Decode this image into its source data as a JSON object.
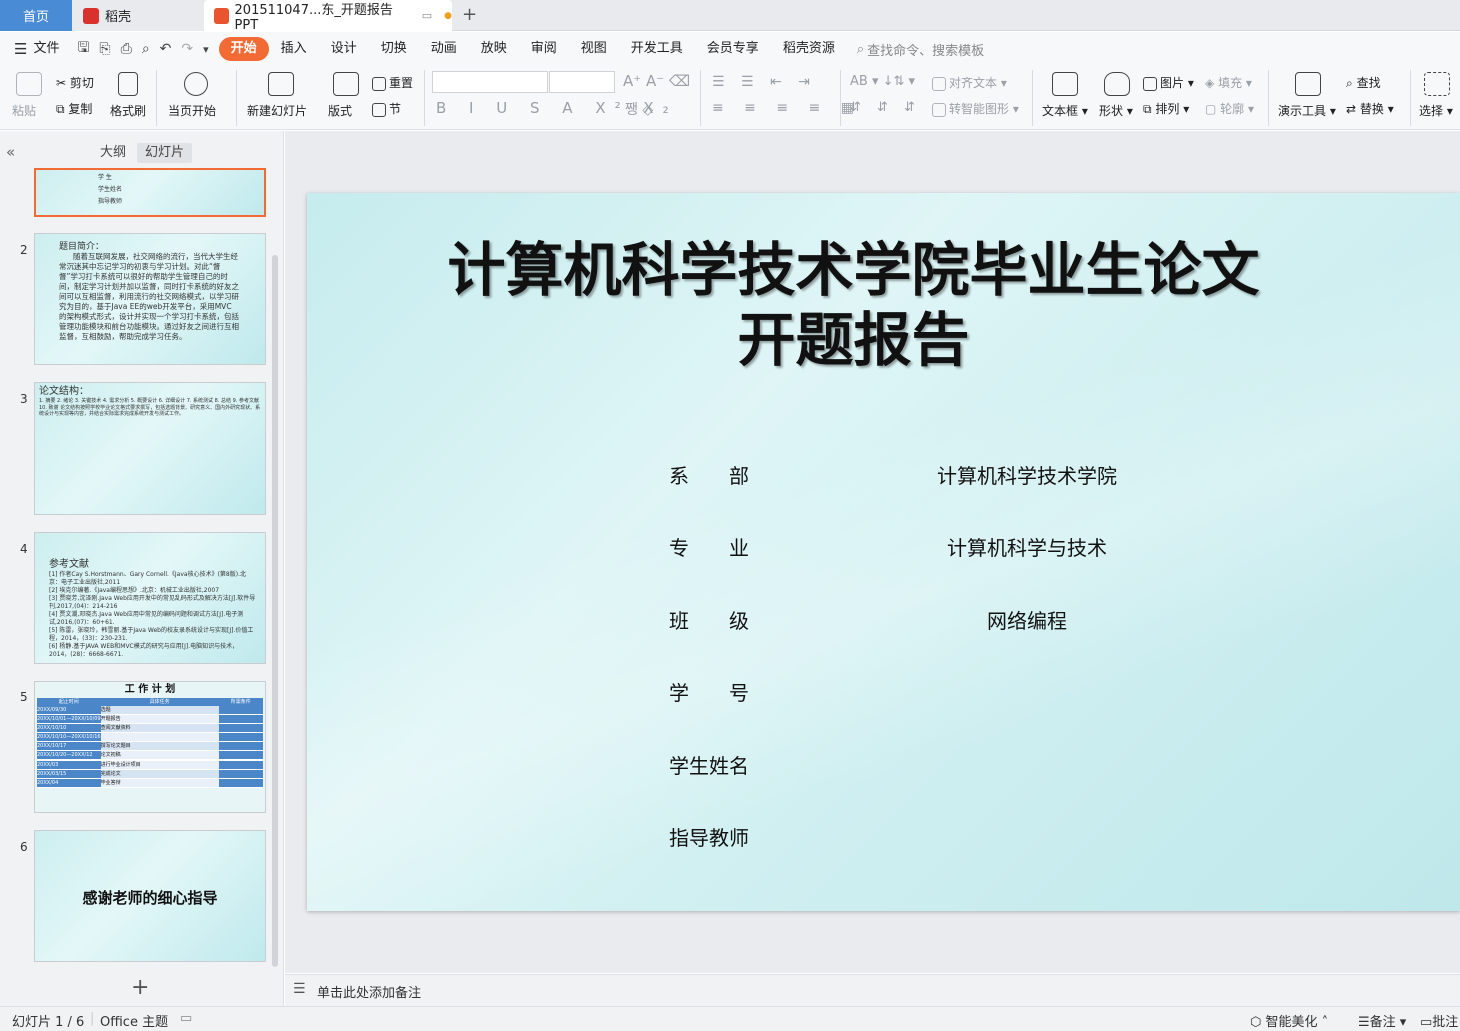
{
  "tabs": {
    "home": "首页",
    "docer": "稻壳",
    "file": "201511047...东_开题报告PPT"
  },
  "menu": {
    "file": "文件",
    "items": [
      "开始",
      "插入",
      "设计",
      "切换",
      "动画",
      "放映",
      "审阅",
      "视图",
      "开发工具",
      "会员专享",
      "稻壳资源"
    ],
    "search_placeholder": "查找命令、搜索模板"
  },
  "toolbar": {
    "paste": "粘贴",
    "cut": "剪切",
    "copy": "复制",
    "format_painter": "格式刷",
    "play_from_current": "当页开始",
    "new_slide": "新建幻灯片",
    "layout": "版式",
    "reset": "重置",
    "section": "节",
    "align_text": "对齐文本",
    "convert_smartart": "转智能图形",
    "textbox": "文本框",
    "shape": "形状",
    "picture": "图片",
    "arrange": "排列",
    "fill": "填充",
    "outline": "轮廓",
    "presenter_tools": "演示工具",
    "find": "查找",
    "replace": "替换",
    "select": "选择"
  },
  "panel": {
    "outline_tab": "大纲",
    "slides_tab": "幻灯片",
    "add_slide": "+"
  },
  "thumbnails": [
    {
      "num": "1",
      "lines": [
        "学 生",
        "学生姓名",
        "指导教师"
      ]
    },
    {
      "num": "2",
      "title": "题目简介：",
      "body": "随着互联网发展，社交网络的流行，当代大学生经常沉迷其中忘记学习的初衷与学习计划。对此“督督”学习打卡系统可以很好的帮助学生管理自己的时间，制定学习计划并加以监督，同时打卡系统的好友之间可以互相监督，利用流行的社交网络模式，以学习研究为目的，基于Java EE的web开发平台，采用MVC的架构模式形式，设计并实现一个学习打卡系统，包括管理功能模块和前台功能模块。通过好友之间进行互相监督，互相鼓励，帮助完成学习任务。"
    },
    {
      "num": "3",
      "title": "论文结构：",
      "body": "1. 摘要 2. 绪论 3. 关键技术 4. 需求分析 5. 概要设计 6. 详细设计 7. 系统测试 8. 总结 9. 参考文献 10. 致谢 论文结构按照学校毕业论文格式要求撰写，包括选题背景、研究意义、国内外研究现状、系统设计与实现等内容，并结合实际需求完成系统开发与测试工作。"
    },
    {
      "num": "4",
      "title": "参考文献",
      "refs": [
        "[1] 作者Cay S.Horstmann、Gary Cornell.《Java核心技术》(第8版).北京：电子工业出版社,2011",
        "[2] 埃克尔编著.《Java编程思想》.北京：机械工业出版社,2007",
        "[3] 贾晓芳,沈泽刚.Java Web应用开发中的常见乱码形式及解决方法[J].软件导刊,2017,(04)：214-216",
        "[4] 贾文潮,邓晓杰.Java Web应用中常见的编码问题和调试方法[J].电子测试,2016,(07)：60+61.",
        "[5] 陈雷，张晓玲，韩雪丽.基于Java Web的校友录系统设计与实现[J].价值工程，2014，(33)：230-231.",
        "[6] 杨静.基于JAVA WEB和MVC模式的研究与应用[J].电脑知识与技术，2014，(28)：6668-6671."
      ]
    },
    {
      "num": "5",
      "title": "工 作 计 划",
      "headers": [
        "起止时间",
        "具体任务",
        "所需条件"
      ],
      "rows": [
        [
          "20XX/09/30",
          "选题"
        ],
        [
          "20XX/10/01—20XX/10/09",
          "开题报告"
        ],
        [
          "20XX/10/10",
          "查阅文献资料"
        ],
        [
          "20XX/10/10—20XX/10/16",
          ""
        ],
        [
          "20XX/10/17",
          "撰写论文题目"
        ],
        [
          "20XX/10/20—20XX/12",
          "论文初稿"
        ],
        [
          "",
          ""
        ],
        [
          "20XX/03",
          "进行毕业设计项目"
        ],
        [
          "20XX/03/15",
          "完成论文"
        ],
        [
          "20XX/04",
          "毕业答辩"
        ]
      ]
    },
    {
      "num": "6",
      "title": "感谢老师的细心指导"
    }
  ],
  "slide": {
    "title_line1": "计算机科学技术学院毕业生论文",
    "title_line2": "开题报告",
    "fields": [
      {
        "label": "系　　部",
        "value": "计算机科学技术学院"
      },
      {
        "label": "专　　业",
        "value": "计算机科学与技术"
      },
      {
        "label": "班　　级",
        "value": "网络编程"
      },
      {
        "label": "学　　号",
        "value": ""
      },
      {
        "label": "学生姓名",
        "value": ""
      },
      {
        "label": "指导教师",
        "value": ""
      }
    ]
  },
  "notes_placeholder": "单击此处添加备注",
  "status": {
    "slide_count": "幻灯片 1 / 6",
    "theme": "Office 主题",
    "beautify": "智能美化",
    "notes": "备注",
    "comments": "批注"
  },
  "colors": {
    "accent": "#f26b35",
    "home_tab": "#4a8bd6",
    "table_header": "#4a86c8"
  }
}
